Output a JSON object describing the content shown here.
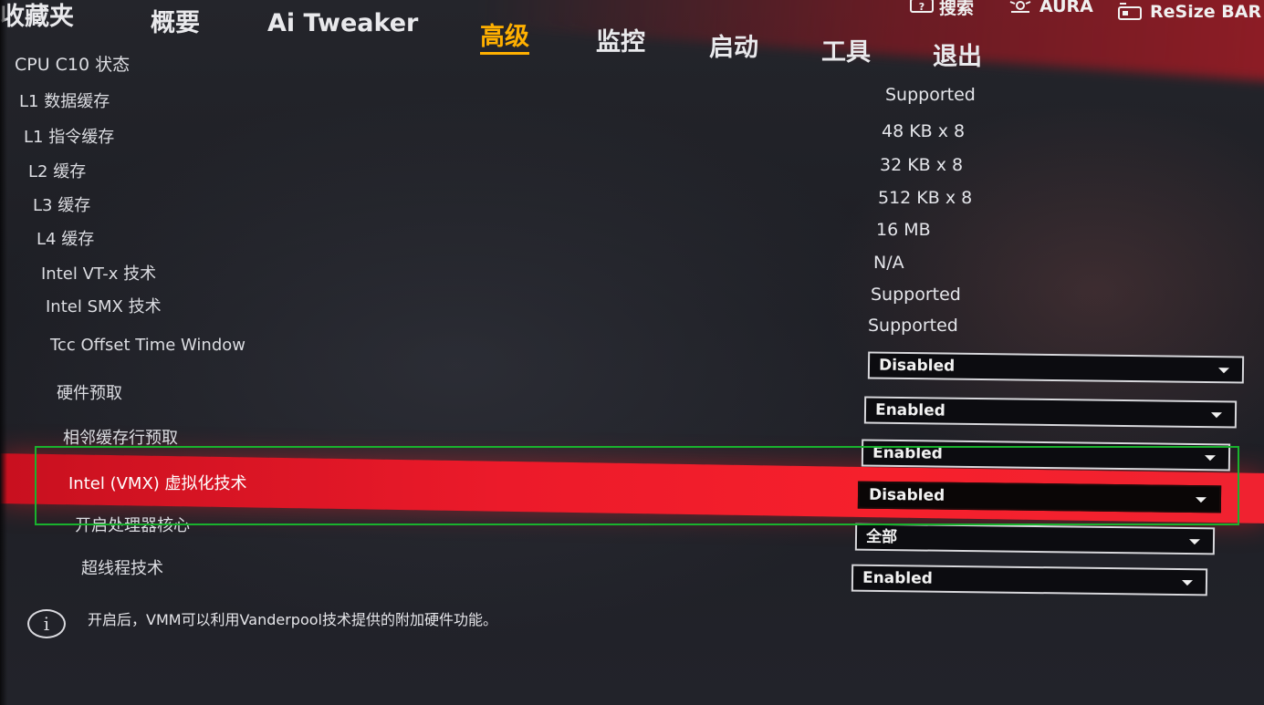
{
  "nav": {
    "tabs": [
      {
        "label": "收藏夹",
        "active": false
      },
      {
        "label": "概要",
        "active": false
      },
      {
        "label": "Ai Tweaker",
        "active": false
      },
      {
        "label": "高级",
        "active": true
      },
      {
        "label": "监控",
        "active": false
      },
      {
        "label": "启动",
        "active": false
      },
      {
        "label": "工具",
        "active": false
      },
      {
        "label": "退出",
        "active": false
      }
    ],
    "utilities": [
      {
        "label": "搜索",
        "icon": "question-box-icon"
      },
      {
        "label": "AURA",
        "icon": "aura-icon"
      },
      {
        "label": "ReSize BAR",
        "icon": "resize-bar-icon"
      }
    ],
    "accent": "#ffb000"
  },
  "section": {
    "title": "CPU C10 状态"
  },
  "info_rows": [
    {
      "label": "L1 数据缓存",
      "value": "Supported"
    },
    {
      "label": "L1 指令缓存",
      "value": "48 KB x 8"
    },
    {
      "label": "L2 缓存",
      "value": "32 KB x 8"
    },
    {
      "label": "L3 缓存",
      "value": "512 KB x 8"
    },
    {
      "label": "L4 缓存",
      "value": "16 MB"
    },
    {
      "label": "Intel VT-x 技术",
      "value": "N/A"
    },
    {
      "label": "Intel SMX 技术",
      "value": "Supported"
    },
    {
      "label": "",
      "value": "Supported"
    }
  ],
  "settings": [
    {
      "label": "Tcc Offset Time Window",
      "value": "Disabled",
      "selected": false
    },
    {
      "label": "硬件预取",
      "value": "Enabled",
      "selected": false
    },
    {
      "label": "相邻缓存行预取",
      "value": "Enabled",
      "selected": false
    },
    {
      "label": "Intel (VMX) 虚拟化技术",
      "value": "Disabled",
      "selected": true
    },
    {
      "label": "开启处理器核心",
      "value": "全部",
      "selected": false
    },
    {
      "label": "超线程技术",
      "value": "Enabled",
      "selected": false
    }
  ],
  "help": {
    "text": "开启后，VMM可以利用Vanderpool技术提供的附加硬件功能。"
  },
  "colors": {
    "highlight_bar": "#ec1a2a",
    "annotation_box": "#19b22e"
  }
}
